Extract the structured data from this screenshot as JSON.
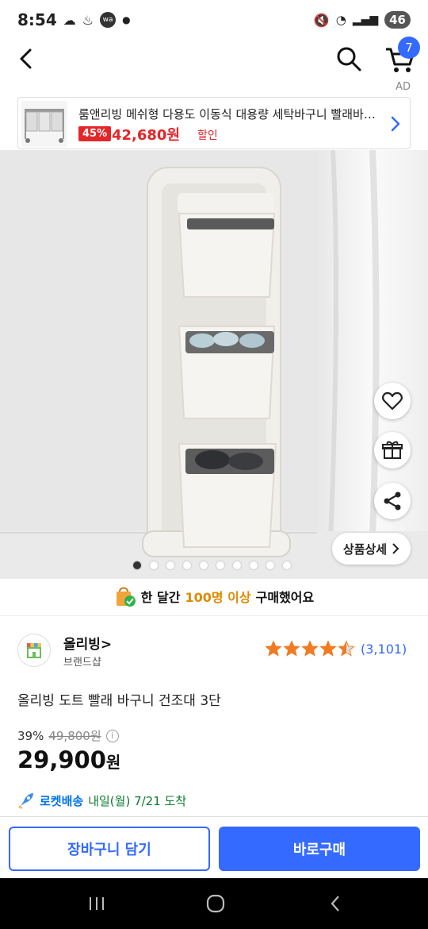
{
  "status_bar": {
    "time": "8:54",
    "battery": "46"
  },
  "cart": {
    "badge": "7"
  },
  "ad": {
    "label": "AD",
    "title": "룸앤리빙 메쉬형 다용도 이동식 대용량 세탁바구니 빨래바구니",
    "discount": "45%",
    "price": "42,680원",
    "sale_label": "할인"
  },
  "image": {
    "page_dots": 10,
    "active_dot": 0,
    "detail_button": "상품상세"
  },
  "bought": {
    "prefix": "한 달간",
    "highlight": "100명 이상",
    "suffix": "구매했어요"
  },
  "seller": {
    "name": "올리빙",
    "type": "브랜드샵"
  },
  "rating": {
    "value": 4.5,
    "count": "(3,101)"
  },
  "product": {
    "title": "올리빙 도트 빨래 바구니 건조대 3단",
    "discount_rate": "39%",
    "original_price": "49,800원",
    "price": "29,900",
    "currency": "원"
  },
  "delivery": {
    "label": "로켓배송",
    "date": "내일(월) 7/21 도착"
  },
  "buttons": {
    "add_cart": "장바구니 담기",
    "buy_now": "바로구매"
  },
  "colors": {
    "accent": "#346aff",
    "sale_red": "#e52528",
    "star": "#f07b22"
  }
}
